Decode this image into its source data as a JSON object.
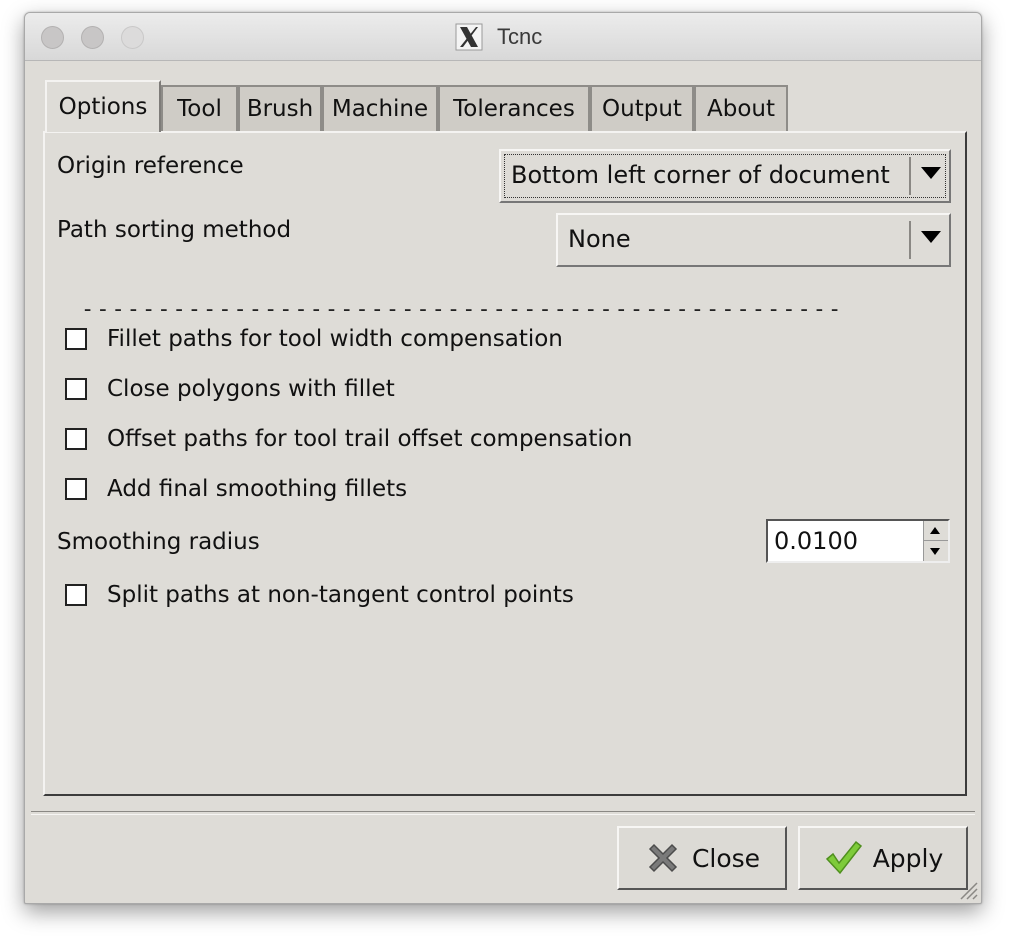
{
  "window": {
    "title": "Tcnc",
    "title_icon": "x11-icon"
  },
  "tabs": [
    {
      "label": "Options",
      "active": true
    },
    {
      "label": "Tool"
    },
    {
      "label": "Brush"
    },
    {
      "label": "Machine"
    },
    {
      "label": "Tolerances"
    },
    {
      "label": "Output"
    },
    {
      "label": "About"
    }
  ],
  "options": {
    "origin_reference": {
      "label": "Origin reference",
      "value": "Bottom left corner of document"
    },
    "path_sorting": {
      "label": "Path sorting method",
      "value": "None"
    },
    "separator": "--------------------------------------------------",
    "checkboxes": [
      {
        "label": "Fillet paths for tool width compensation",
        "checked": false
      },
      {
        "label": "Close polygons with fillet",
        "checked": false
      },
      {
        "label": "Offset paths for tool trail offset compensation",
        "checked": false
      },
      {
        "label": "Add final smoothing fillets",
        "checked": false
      }
    ],
    "smoothing_radius": {
      "label": "Smoothing radius",
      "value": "0.0100"
    },
    "split_paths": {
      "label": "Split paths at non-tangent control points",
      "checked": false
    }
  },
  "buttons": {
    "close_label": "Close",
    "apply_label": "Apply"
  },
  "colors": {
    "window_bg": "#dedcd7",
    "apply_check": "#7ecb3a",
    "close_x": "#7a7a7a"
  }
}
